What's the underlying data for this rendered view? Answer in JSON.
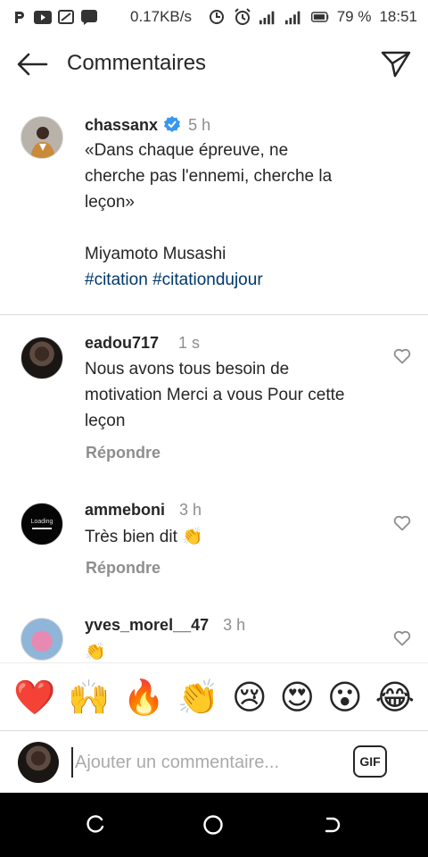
{
  "status_bar": {
    "speed": "0.17KB/s",
    "battery": "79 %",
    "time": "18:51"
  },
  "header": {
    "title": "Commentaires"
  },
  "caption": {
    "username": "chassanx",
    "time": "5 h",
    "line1": "«Dans chaque épreuve, ne",
    "line2": "cherche pas l'ennemi, cherche la",
    "line3": "leçon»",
    "author": "Miyamoto Musashi",
    "hashtag1": "#citation",
    "hashtag2": "#citationdujour"
  },
  "comments": [
    {
      "username": "eadou717",
      "time": "1 s",
      "line1": "Nous avons tous besoin de",
      "line2": "motivation Merci a vous Pour cette",
      "line3": "leçon",
      "reply": "Répondre"
    },
    {
      "username": "ammeboni",
      "time": "3 h",
      "line1": "Très bien dit 👏",
      "reply": "Répondre",
      "avatar_text": "Loading"
    },
    {
      "username": "yves_morel__47",
      "time": "3 h",
      "line1": "👏"
    }
  ],
  "emoji_bar": [
    "❤️",
    "🙌",
    "🔥",
    "👏",
    "😢",
    "😍",
    "😮",
    "😂"
  ],
  "input": {
    "placeholder": "Ajouter un commentaire...",
    "gif_label": "GIF"
  },
  "colors": {
    "verified": "#3897f0",
    "hashtag": "#00376b",
    "muted": "#8e8e8e"
  }
}
